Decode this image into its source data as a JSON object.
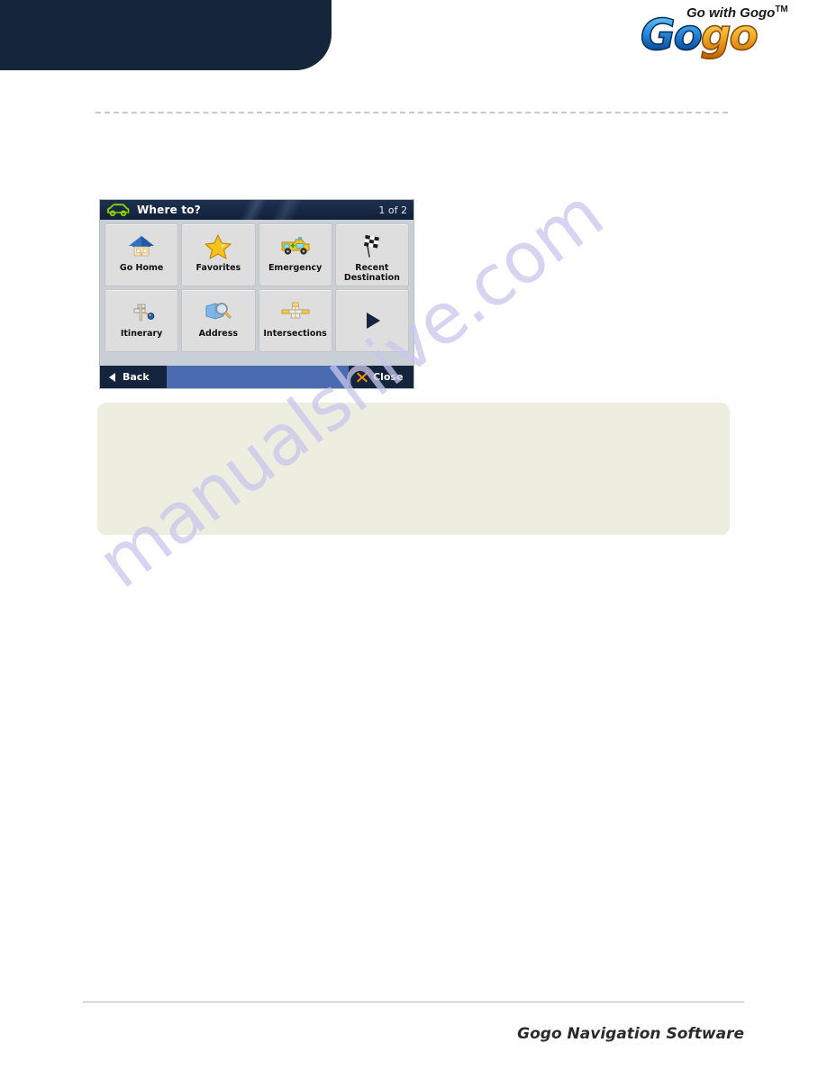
{
  "header": {
    "logo": {
      "tagline": "Go with Gogo",
      "trademark": "TM",
      "wordmark_blue": "Go",
      "wordmark_gold": "go"
    }
  },
  "device": {
    "titlebar": {
      "icon": "car-icon",
      "title": "Where to?",
      "page_indicator": "1 of 2"
    },
    "tiles": [
      {
        "label": "Go Home",
        "icon": "house-icon",
        "name": "tile-go-home"
      },
      {
        "label": "Favorites",
        "icon": "star-icon",
        "name": "tile-favorites"
      },
      {
        "label": "Emergency",
        "icon": "ambulance-icon",
        "name": "tile-emergency"
      },
      {
        "label": "Recent\nDestination",
        "icon": "checkered-flag-icon",
        "name": "tile-recent-destination"
      },
      {
        "label": "Itinerary",
        "icon": "signpost-icon",
        "name": "tile-itinerary"
      },
      {
        "label": "Address",
        "icon": "map-magnifier-icon",
        "name": "tile-address"
      },
      {
        "label": "Intersections",
        "icon": "crossroads-icon",
        "name": "tile-intersections"
      },
      {
        "label": "",
        "icon": "next-page-arrow-icon",
        "name": "tile-next-page"
      }
    ],
    "tile_labels": {
      "go_home": "Go Home",
      "favorites": "Favorites",
      "emergency": "Emergency",
      "recent_destination_line1": "Recent",
      "recent_destination_line2": "Destination",
      "itinerary": "Itinerary",
      "address": "Address",
      "intersections": "Intersections"
    },
    "footer": {
      "back_label": "Back",
      "back_icon": "left-triangle-icon",
      "close_label": "Close",
      "close_icon": "x-mark-icon"
    }
  },
  "note_box": {
    "text": ""
  },
  "watermark": {
    "text": "manualshive.com"
  },
  "page_footer": {
    "text": "Gogo Navigation Software"
  },
  "colors": {
    "header_navy": "#16263a",
    "titlebar_navy": "#15243d",
    "footer_blue": "#4a6bb0",
    "tile_gray": "#dedede",
    "note_cream": "#eeeee0",
    "logo_blue": "#2b8fe0",
    "logo_gold": "#f6b431",
    "close_orange": "#f08a12",
    "car_green": "#8fd400"
  }
}
